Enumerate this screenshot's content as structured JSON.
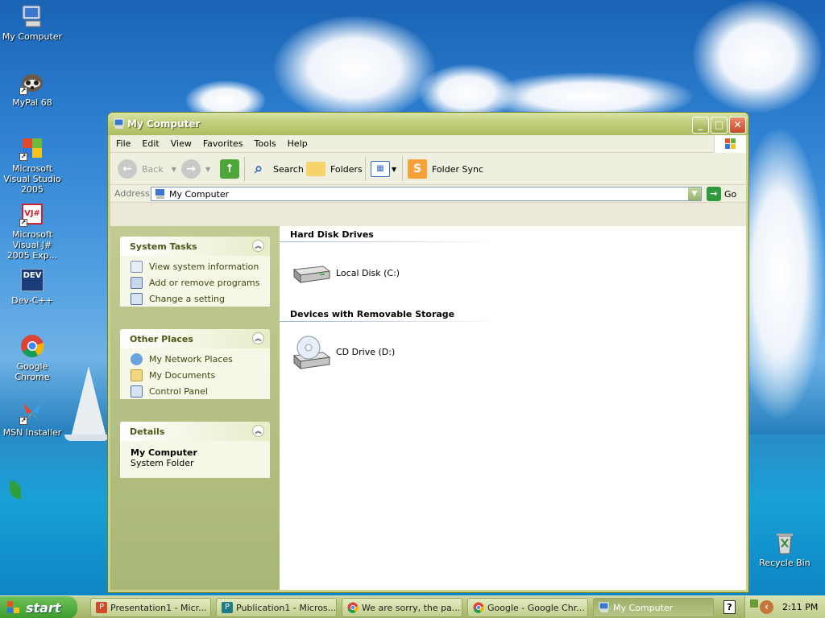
{
  "desktop": {
    "icons": [
      {
        "label": "My Computer"
      },
      {
        "label": "MyPal 68"
      },
      {
        "label": "Microsoft Visual Studio 2005"
      },
      {
        "label": "Microsoft Visual J# 2005 Exp..."
      },
      {
        "label": "Dev-C++"
      },
      {
        "label": "Google Chrome"
      },
      {
        "label": "MSN Installer"
      },
      {
        "label": "Recycle Bin"
      }
    ],
    "dev_badge": "DEV",
    "vj_badge": "VJ#"
  },
  "window": {
    "title": "My Computer",
    "menu": [
      "File",
      "Edit",
      "View",
      "Favorites",
      "Tools",
      "Help"
    ],
    "toolbar": {
      "back": "Back",
      "search": "Search",
      "folders": "Folders",
      "folder_sync": "Folder Sync"
    },
    "address": {
      "label": "Address",
      "value": "My Computer",
      "go": "Go"
    },
    "tasks": {
      "system_tasks": {
        "title": "System Tasks",
        "items": [
          "View system information",
          "Add or remove programs",
          "Change a setting"
        ]
      },
      "other_places": {
        "title": "Other Places",
        "items": [
          "My Network Places",
          "My Documents",
          "Control Panel"
        ]
      },
      "details": {
        "title": "Details",
        "name": "My Computer",
        "type": "System Folder"
      }
    },
    "content": {
      "hdd_group": "Hard Disk Drives",
      "local_disk": "Local Disk (C:)",
      "removable_group": "Devices with Removable Storage",
      "cd_drive": "CD Drive (D:)"
    }
  },
  "taskbar": {
    "start": "start",
    "tasks": [
      {
        "label": "Presentation1 - Micr...",
        "icon": "powerpoint-icon"
      },
      {
        "label": "Publication1 - Micros...",
        "icon": "publisher-icon"
      },
      {
        "label": "We are sorry, the pa...",
        "icon": "chrome-icon"
      },
      {
        "label": "Google - Google Chr...",
        "icon": "chrome-icon"
      },
      {
        "label": "My Computer",
        "icon": "my-computer-icon"
      }
    ],
    "clock": "2:11 PM"
  }
}
